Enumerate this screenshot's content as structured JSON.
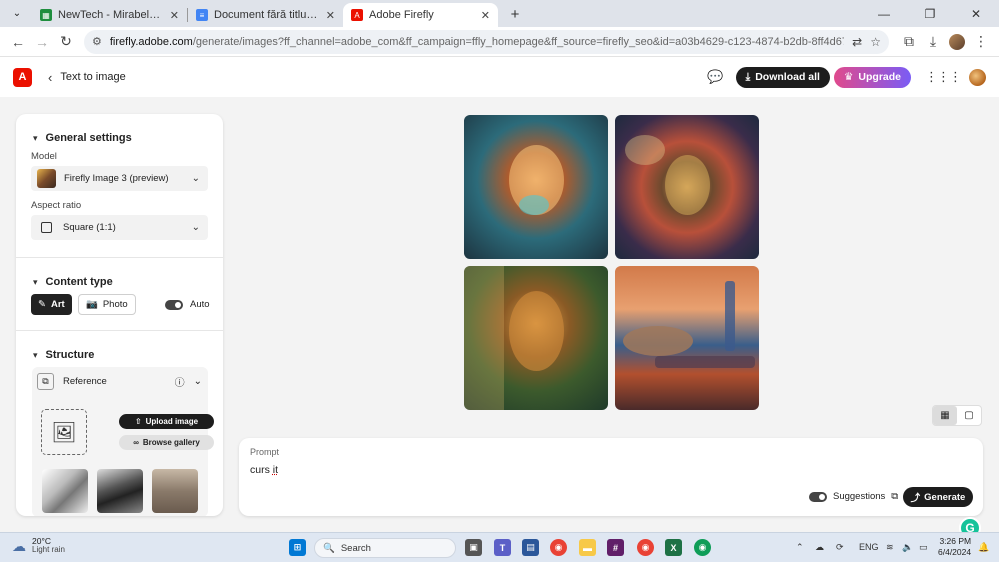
{
  "browser": {
    "tabs": [
      {
        "title": "NewTech - Mirabela - Foi de ca",
        "favicon_color": "#1e8e3e",
        "active": false
      },
      {
        "title": "Document fără titlu - Documen",
        "favicon_color": "#4285f4",
        "active": false
      },
      {
        "title": "Adobe Firefly",
        "favicon_color": "#eb1000",
        "active": true
      }
    ],
    "url_host": "firefly.adobe.com",
    "url_rest": "/generate/images?ff_channel=adobe_com&ff_campaign=ffly_homepage&ff_source=firefly_seo&id=a03b4629-c123-4874-b2db-8ff4d67c2462"
  },
  "header": {
    "back_label": "Text to image",
    "download_all": "Download all",
    "upgrade": "Upgrade"
  },
  "settings": {
    "general_title": "General settings",
    "model_label": "Model",
    "model_value": "Firefly Image 3 (preview)",
    "aspect_label": "Aspect ratio",
    "aspect_value": "Square (1:1)",
    "content_type_title": "Content type",
    "art_label": "Art",
    "photo_label": "Photo",
    "auto_label": "Auto",
    "structure_title": "Structure",
    "reference_label": "Reference",
    "upload_image": "Upload image",
    "browse_gallery": "Browse gallery"
  },
  "prompt": {
    "label": "Prompt",
    "value_plain": "curs ",
    "value_marked": "it",
    "suggestions_label": "Suggestions",
    "generate_label": "Generate"
  },
  "taskbar": {
    "temp": "20°C",
    "condition": "Light rain",
    "search_placeholder": "Search",
    "lang": "ENG",
    "time": "3:26 PM",
    "date": "6/4/2024"
  }
}
